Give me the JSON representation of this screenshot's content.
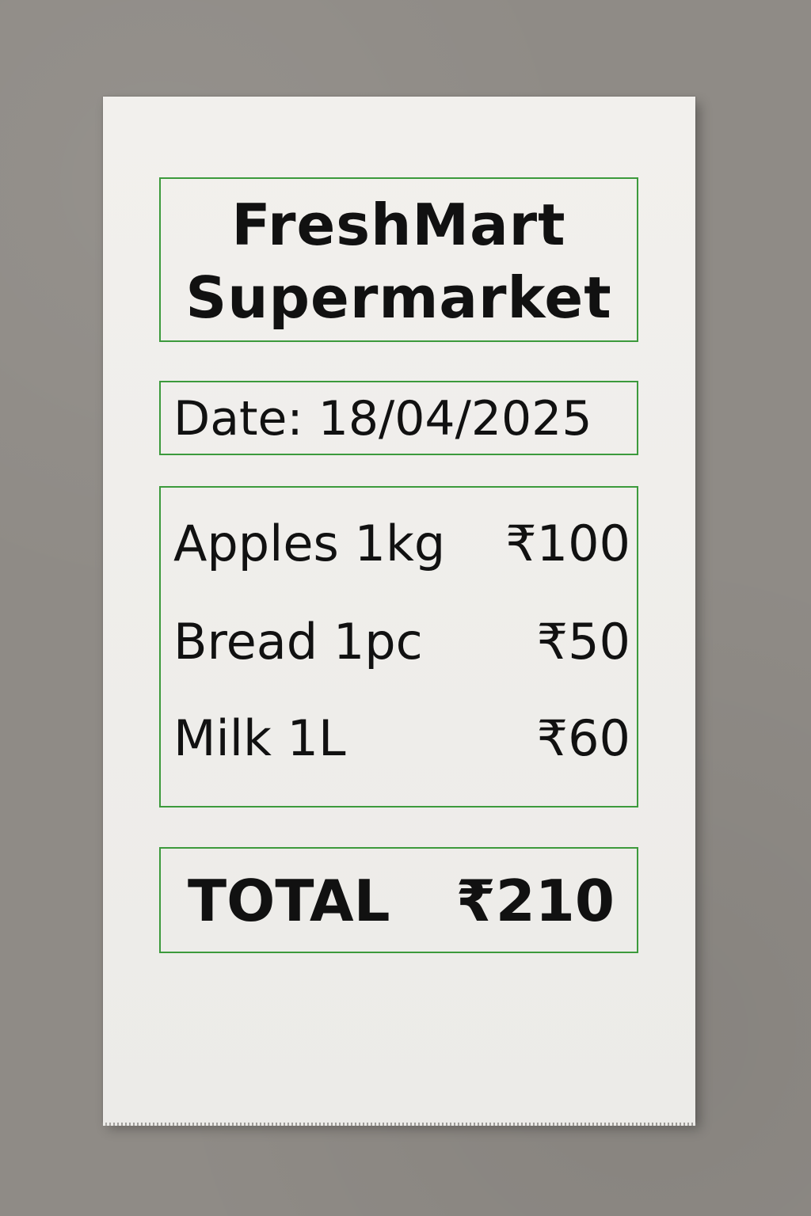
{
  "receipt": {
    "store_name": "FreshMart\nSupermarket",
    "date": "Date: 18/04/2025",
    "items": [
      {
        "name": "Apples 1kg",
        "price": "₹100"
      },
      {
        "name": "Bread 1pc",
        "price": "₹50"
      },
      {
        "name": "Milk 1L",
        "price": "₹60"
      }
    ],
    "total_label": "TOTAL",
    "total_value": "₹210"
  },
  "colors": {
    "border_accent": "#3c9a3c",
    "paper": "#efedea",
    "background": "#8f8b86",
    "text": "#111111"
  }
}
